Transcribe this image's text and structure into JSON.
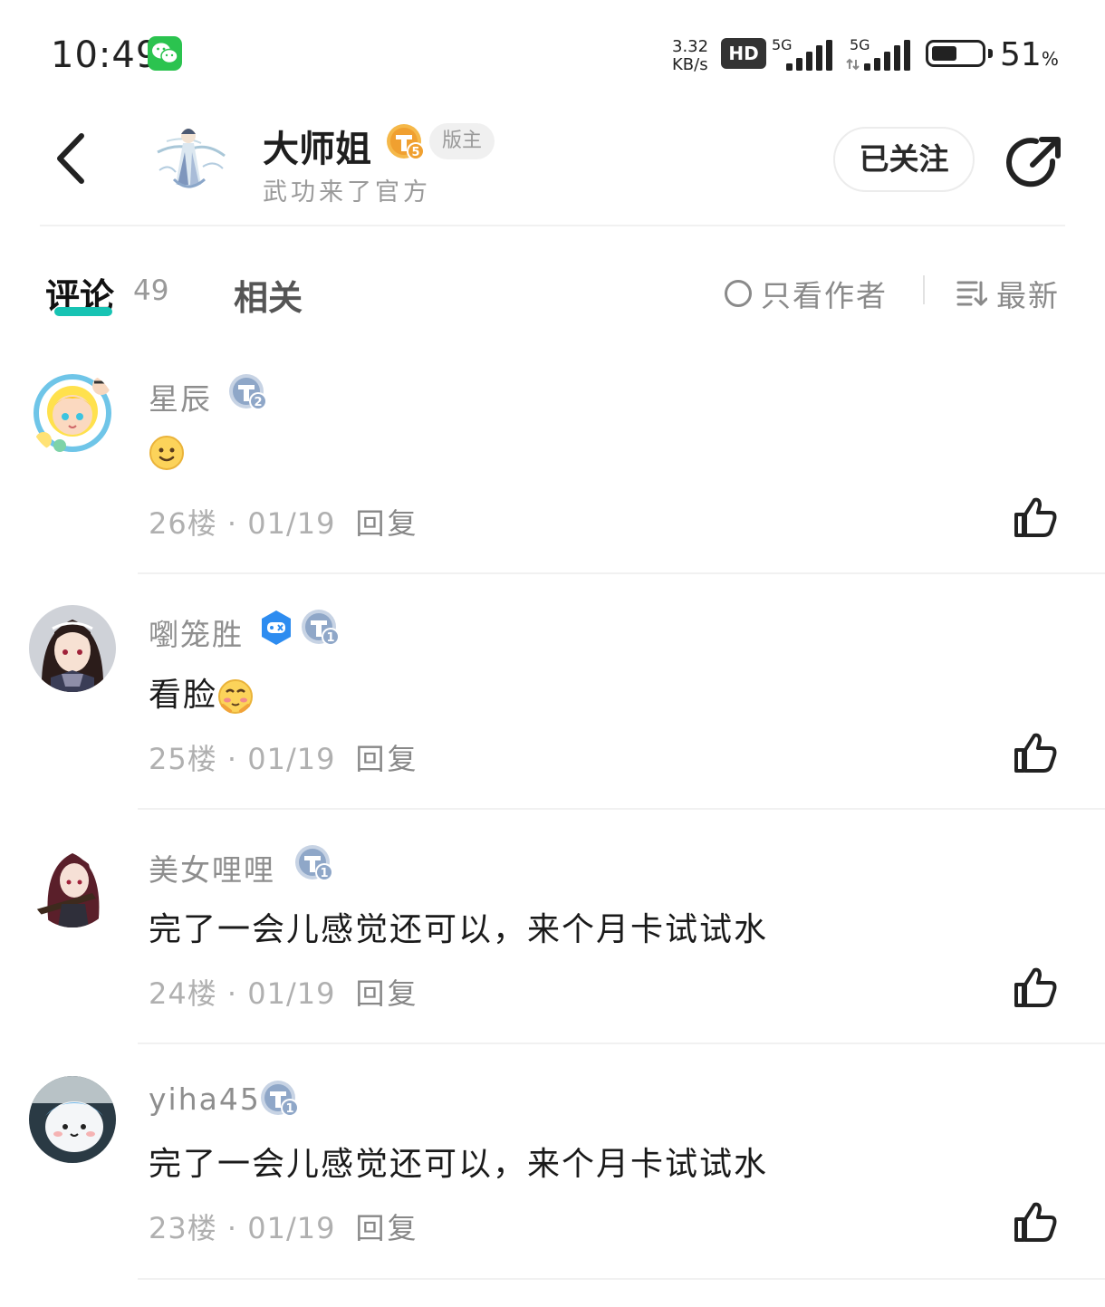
{
  "status_bar": {
    "time": "10:49",
    "net_speed_value": "3.32",
    "net_speed_unit": "KB/s",
    "hd_label": "HD",
    "sim1_label": "5G",
    "sim2_label": "5G",
    "battery_percent": "51",
    "battery_percent_sign": "%",
    "battery_level": 0.51
  },
  "header": {
    "author_name": "大师姐",
    "author_level": "5",
    "moderator_tag": "版主",
    "author_subtitle": "武功来了官方",
    "follow_label": "已关注"
  },
  "tabs": {
    "comments_label": "评论",
    "comments_count": "49",
    "related_label": "相关",
    "only_author_label": "只看作者",
    "sort_label": "最新"
  },
  "comments": [
    {
      "username": "星辰",
      "level": "2",
      "text": "",
      "floor": "26楼",
      "date": "01/19",
      "reply": "回复"
    },
    {
      "username": "嚠笼胜",
      "level": "1",
      "text": "看脸",
      "floor": "25楼",
      "date": "01/19",
      "reply": "回复"
    },
    {
      "username": "美女哩哩",
      "level": "1",
      "text": "完了一会儿感觉还可以，来个月卡试试水",
      "floor": "24楼",
      "date": "01/19",
      "reply": "回复"
    },
    {
      "username": "yiha45",
      "level": "1",
      "text": "完了一会儿感觉还可以，来个月卡试试水",
      "floor": "23楼",
      "date": "01/19",
      "reply": "回复"
    }
  ],
  "meta_separator": "·",
  "colors": {
    "accent": "#17c3b3",
    "level_badge_gold": "#f0a030",
    "level_badge_blue": "#8fa7c8",
    "wechat_green": "#2bc34f"
  }
}
